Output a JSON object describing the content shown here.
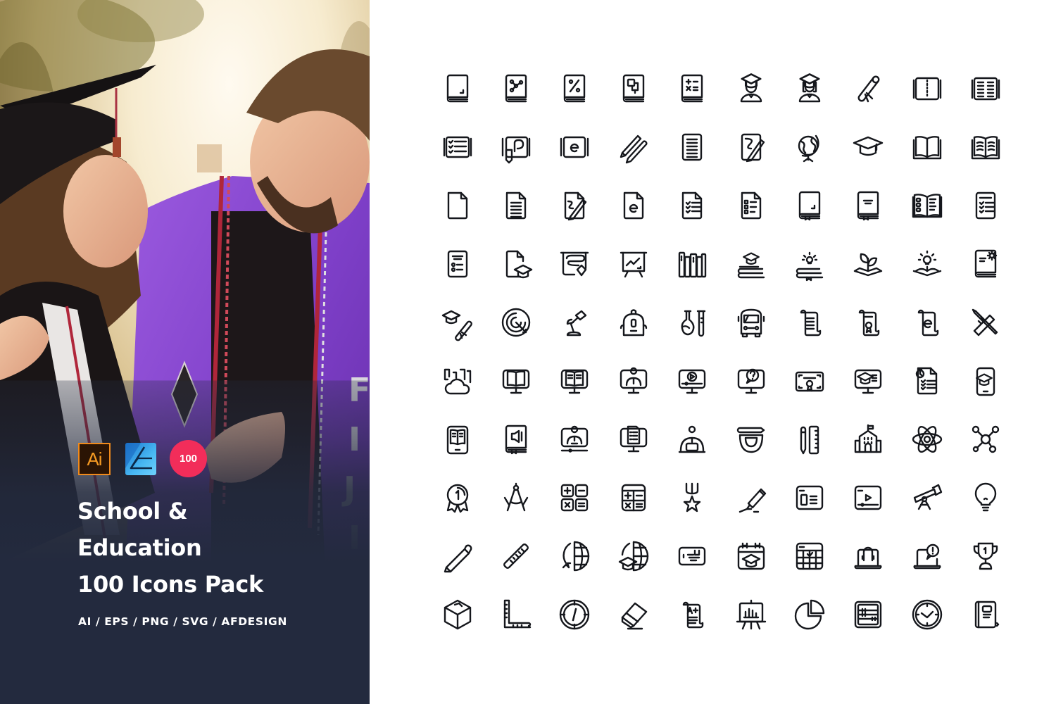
{
  "hero": {
    "title_lines": [
      "School &",
      "Education",
      "100 Icons Pack"
    ],
    "formats": "AI / EPS / PNG / SVG / AFDESIGN",
    "badges": {
      "illustrator": {
        "label": "Ai",
        "name": "adobe-illustrator",
        "color": "#f08a1c"
      },
      "affinity": {
        "name": "affinity-designer",
        "color": "#48b8f3"
      },
      "count": {
        "label": "100",
        "color": "#f22d5a"
      }
    },
    "photo_subject": "graduating couple in caps, gowns and stoles"
  },
  "icon_grid": {
    "rows": 10,
    "columns": 10,
    "stroke_color": "#15171c",
    "icons": [
      "book",
      "science-book",
      "math-book",
      "geometry-book",
      "calculator-book",
      "graduate-male",
      "graduate-female",
      "diploma",
      "notebook",
      "open-textbook",
      "checklist-notebook",
      "drawing-notebook",
      "notebook-e",
      "pencil-and-pen",
      "document-lines",
      "writing-paper",
      "globe",
      "graduation-cap",
      "open-book",
      "reading-book",
      "blank-file",
      "text-file",
      "signing-file",
      "e-file",
      "checklist-file",
      "quiz-file",
      "closed-book",
      "book-title",
      "open-book-quiz",
      "test-sheet",
      "exam-sheet",
      "graduation-file",
      "whiteboard-pen",
      "presentation-board",
      "bookshelf",
      "books-graduation",
      "books-idea",
      "growing-knowledge",
      "book-idea",
      "book-settings",
      "graduation-diploma",
      "target",
      "desk-lamp",
      "backpack",
      "chemistry",
      "school-bus",
      "scroll",
      "certificate-scroll",
      "e-scroll",
      "pencil-ruler",
      "cloud-library",
      "online-book",
      "ebook-monitor",
      "online-teacher",
      "video-lesson",
      "online-question",
      "certificate",
      "online-graduation",
      "timed-test",
      "mobile-learning",
      "ebook-tablet",
      "audio-book",
      "webinar",
      "online-document",
      "student-laptop",
      "protractor-pencil",
      "pencil-and-ruler",
      "school-building",
      "atom",
      "molecule",
      "first-place-medal",
      "compass-tool",
      "calculator-keys",
      "calculator",
      "star-medal",
      "highlighter",
      "browser-content",
      "browser-video",
      "telescope",
      "light-bulb",
      "pencil",
      "ruler",
      "world-knowledge",
      "global-education",
      "id-card",
      "graduation-calendar",
      "calendar-check",
      "online-support",
      "laptop-alert",
      "trophy",
      "cube",
      "set-square",
      "compass",
      "eraser",
      "grade-scroll",
      "presentation-chart",
      "pie-chart",
      "abacus",
      "clock",
      "notebook-closed"
    ]
  }
}
